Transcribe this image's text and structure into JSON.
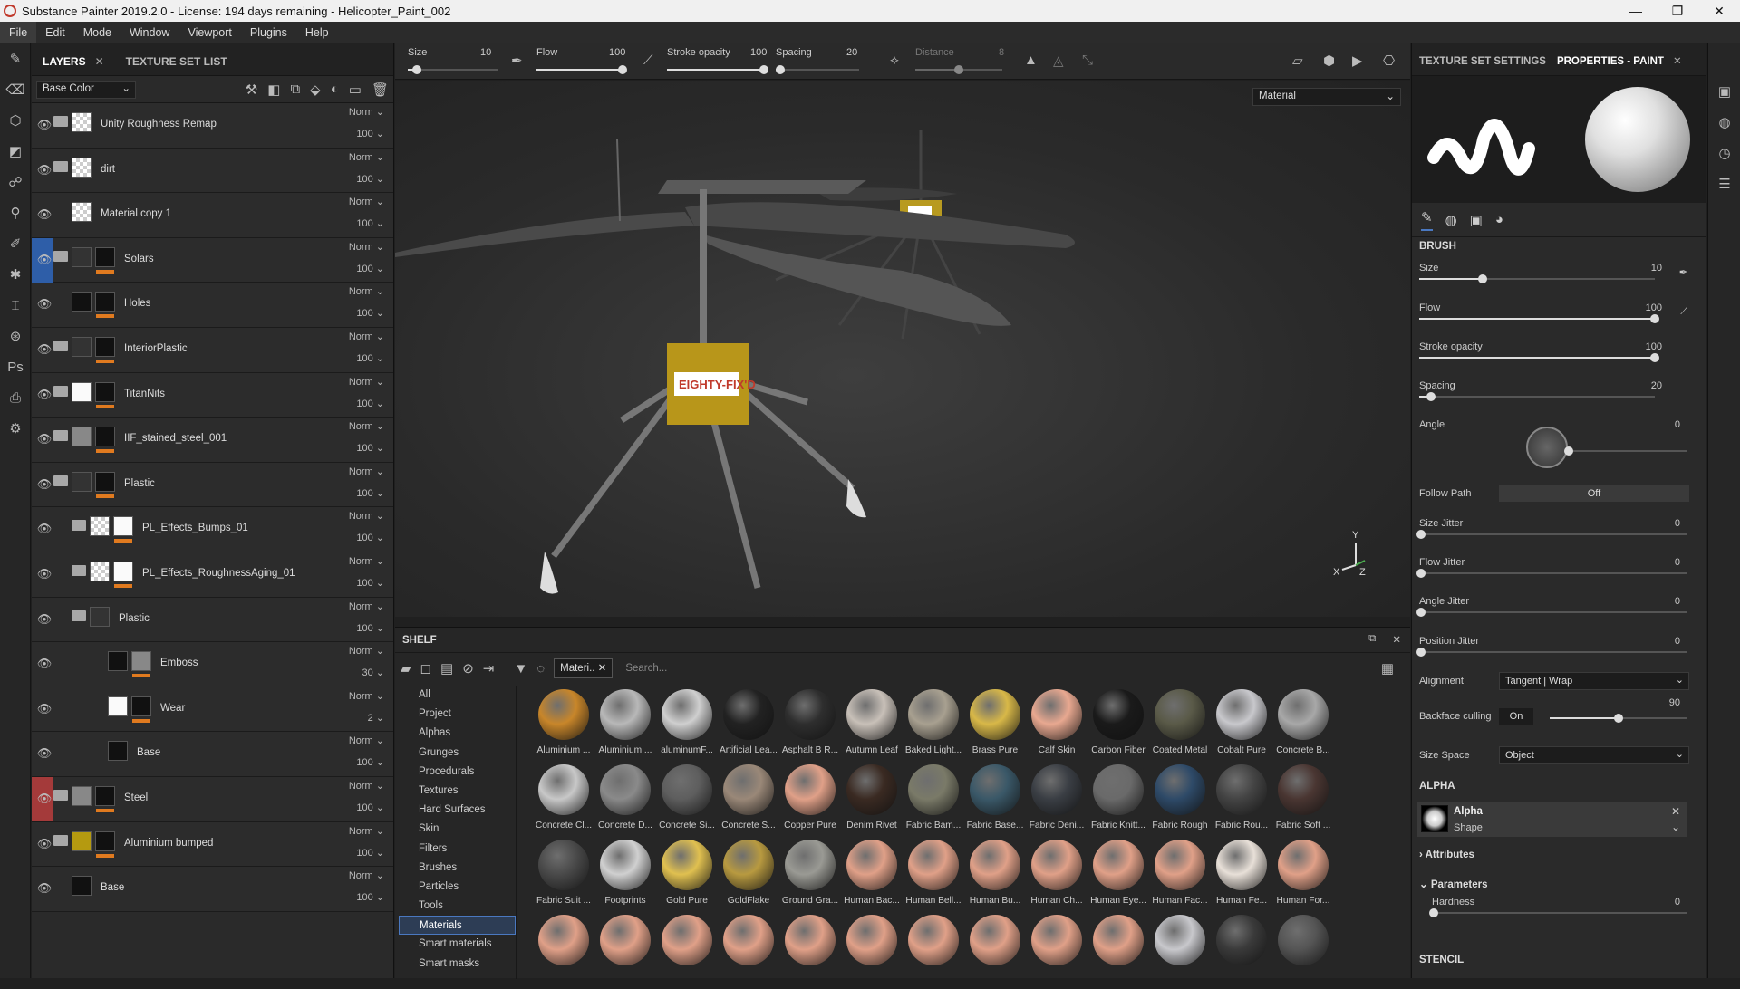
{
  "title": "Substance Painter 2019.2.0 - License: 194 days remaining - Helicopter_Paint_002",
  "window_controls": [
    "—",
    "❐",
    "✕"
  ],
  "menu": [
    "File",
    "Edit",
    "Mode",
    "Window",
    "Viewport",
    "Plugins",
    "Help"
  ],
  "layers_panel": {
    "tabs": [
      "LAYERS",
      "TEXTURE SET LIST"
    ],
    "channel": "Base Color",
    "layers": [
      {
        "name": "Unity Roughness Remap",
        "blend": "Norm",
        "opacity": "100",
        "folder": true,
        "thumb": "check",
        "mask": null,
        "indent": 0,
        "eye": "normal"
      },
      {
        "name": "dirt",
        "blend": "Norm",
        "opacity": "100",
        "folder": true,
        "thumb": "check",
        "mask": null,
        "indent": 0,
        "eye": "normal"
      },
      {
        "name": "Material copy 1",
        "blend": "Norm",
        "opacity": "100",
        "folder": false,
        "thumb": "check",
        "mask": null,
        "indent": 0,
        "eye": "normal"
      },
      {
        "name": "Solars",
        "blend": "Norm",
        "opacity": "100",
        "folder": true,
        "thumb": "dark",
        "mask": "black",
        "indent": 0,
        "eye": "blue"
      },
      {
        "name": "Holes",
        "blend": "Norm",
        "opacity": "100",
        "folder": false,
        "thumb": "black",
        "mask": "black",
        "indent": 0,
        "eye": "normal"
      },
      {
        "name": "InteriorPlastic",
        "blend": "Norm",
        "opacity": "100",
        "folder": true,
        "thumb": "dark",
        "mask": "black",
        "indent": 0,
        "eye": "normal"
      },
      {
        "name": "TitanNits",
        "blend": "Norm",
        "opacity": "100",
        "folder": true,
        "thumb": "white",
        "mask": "black",
        "indent": 0,
        "eye": "normal"
      },
      {
        "name": "IIF_stained_steel_001",
        "blend": "Norm",
        "opacity": "100",
        "folder": true,
        "thumb": "grey",
        "mask": "black",
        "indent": 0,
        "eye": "normal"
      },
      {
        "name": "Plastic",
        "blend": "Norm",
        "opacity": "100",
        "folder": true,
        "thumb": "dark",
        "mask": "black",
        "indent": 0,
        "eye": "normal"
      },
      {
        "name": "PL_Effects_Bumps_01",
        "blend": "Norm",
        "opacity": "100",
        "folder": true,
        "thumb": "check",
        "mask": "white",
        "indent": 1,
        "eye": "normal"
      },
      {
        "name": "PL_Effects_RoughnessAging_01",
        "blend": "Norm",
        "opacity": "100",
        "folder": true,
        "thumb": "check",
        "mask": "white",
        "indent": 1,
        "eye": "normal"
      },
      {
        "name": "Plastic",
        "blend": "Norm",
        "opacity": "100",
        "folder": true,
        "thumb": "dark",
        "mask": null,
        "indent": 1,
        "eye": "normal"
      },
      {
        "name": "Emboss",
        "blend": "Norm",
        "opacity": "30",
        "folder": false,
        "thumb": "black",
        "mask": "grey",
        "indent": 2,
        "eye": "normal"
      },
      {
        "name": "Wear",
        "blend": "Norm",
        "opacity": "2",
        "folder": false,
        "thumb": "white",
        "mask": "black",
        "indent": 2,
        "eye": "normal"
      },
      {
        "name": "Base",
        "blend": "Norm",
        "opacity": "100",
        "folder": false,
        "thumb": "black",
        "mask": null,
        "indent": 2,
        "eye": "normal"
      },
      {
        "name": "Steel",
        "blend": "Norm",
        "opacity": "100",
        "folder": true,
        "thumb": "grey",
        "mask": "black",
        "indent": 0,
        "eye": "red"
      },
      {
        "name": "Aluminium bumped",
        "blend": "Norm",
        "opacity": "100",
        "folder": true,
        "thumb": "gold",
        "mask": "black",
        "indent": 0,
        "eye": "normal"
      },
      {
        "name": "Base",
        "blend": "Norm",
        "opacity": "100",
        "folder": false,
        "thumb": "black",
        "mask": null,
        "indent": 0,
        "eye": "normal"
      }
    ]
  },
  "toolbar": {
    "size_label": "Size",
    "size_value": "10",
    "size_level": 0.1,
    "flow_label": "Flow",
    "flow_value": "100",
    "flow_level": 1.0,
    "stroke_label": "Stroke opacity",
    "stroke_value": "100",
    "stroke_level": 1.0,
    "spacing_label": "Spacing",
    "spacing_value": "20",
    "spacing_level": 0.05,
    "distance_label": "Distance",
    "distance_value": "8",
    "distance_level": 0.5
  },
  "viewport": {
    "display_mode": "Material",
    "decal_text": "EIGHTY-FIX'D",
    "axis_y": "Y",
    "axis_x": "X",
    "axis_z": "Z"
  },
  "shelf": {
    "title": "SHELF",
    "filter": "Materi..",
    "search_placeholder": "Search...",
    "categories": [
      "All",
      "Project",
      "Alphas",
      "Grunges",
      "Procedurals",
      "Textures",
      "Hard Surfaces",
      "Skin",
      "Filters",
      "Brushes",
      "Particles",
      "Tools",
      "Materials",
      "Smart materials",
      "Smart masks"
    ],
    "selected_category": "Materials",
    "materials": [
      {
        "name": "Aluminium ...",
        "color": "#c8862a"
      },
      {
        "name": "Aluminium ...",
        "color": "#b8b8b8"
      },
      {
        "name": "aluminumF...",
        "color": "#cfcfcf"
      },
      {
        "name": "Artificial Lea...",
        "color": "#222"
      },
      {
        "name": "Asphalt B R...",
        "color": "#2e2e2e"
      },
      {
        "name": "Autumn Leaf",
        "color": "#c8c0b8"
      },
      {
        "name": "Baked Light...",
        "color": "#a8a090"
      },
      {
        "name": "Brass Pure",
        "color": "#d8b848"
      },
      {
        "name": "Calf Skin",
        "color": "#e8a890"
      },
      {
        "name": "Carbon Fiber",
        "color": "#1a1a1a"
      },
      {
        "name": "Coated Metal",
        "color": "#5a5a48"
      },
      {
        "name": "Cobalt Pure",
        "color": "#c8c8cc"
      },
      {
        "name": "Concrete B...",
        "color": "#a8a8a8"
      },
      {
        "name": "Concrete Cl...",
        "color": "#c8c8c8"
      },
      {
        "name": "Concrete D...",
        "color": "#8a8a8a"
      },
      {
        "name": "Concrete Si...",
        "color": "#5e5e5e"
      },
      {
        "name": "Concrete S...",
        "color": "#9a8878"
      },
      {
        "name": "Copper Pure",
        "color": "#e0a088"
      },
      {
        "name": "Denim Rivet",
        "color": "#3a2a22"
      },
      {
        "name": "Fabric Bam...",
        "color": "#7a7a68"
      },
      {
        "name": "Fabric Base...",
        "color": "#3a5868"
      },
      {
        "name": "Fabric Deni...",
        "color": "#3a3e44"
      },
      {
        "name": "Fabric Knitt...",
        "color": "#6a6a6a"
      },
      {
        "name": "Fabric Rough",
        "color": "#2e4a68"
      },
      {
        "name": "Fabric Rou...",
        "color": "#444"
      },
      {
        "name": "Fabric Soft ...",
        "color": "#4a3632"
      },
      {
        "name": "Fabric Suit ...",
        "color": "#4a4a4a"
      },
      {
        "name": "Footprints",
        "color": "#d0d0d0"
      },
      {
        "name": "Gold Pure",
        "color": "#e0c050"
      },
      {
        "name": "GoldFlake",
        "color": "#b89a40"
      },
      {
        "name": "Ground Gra...",
        "color": "#9a9a94"
      },
      {
        "name": "Human Bac...",
        "color": "#e0a088"
      },
      {
        "name": "Human Bell...",
        "color": "#e0a088"
      },
      {
        "name": "Human Bu...",
        "color": "#e0a088"
      },
      {
        "name": "Human Ch...",
        "color": "#e0a088"
      },
      {
        "name": "Human Eye...",
        "color": "#e0a088"
      },
      {
        "name": "Human Fac...",
        "color": "#e0a088"
      },
      {
        "name": "Human Fe...",
        "color": "#e8e0d8"
      },
      {
        "name": "Human For...",
        "color": "#e0a088"
      },
      {
        "name": "",
        "color": "#e0a088"
      },
      {
        "name": "",
        "color": "#e0a088"
      },
      {
        "name": "",
        "color": "#e0a088"
      },
      {
        "name": "",
        "color": "#e0a088"
      },
      {
        "name": "",
        "color": "#e0a088"
      },
      {
        "name": "",
        "color": "#e0a088"
      },
      {
        "name": "",
        "color": "#e0a088"
      },
      {
        "name": "",
        "color": "#e0a088"
      },
      {
        "name": "",
        "color": "#e0a088"
      },
      {
        "name": "",
        "color": "#e0a088"
      },
      {
        "name": "",
        "color": "#c8c8cc"
      },
      {
        "name": "",
        "color": "#3a3a3a"
      },
      {
        "name": "",
        "color": "#555"
      }
    ]
  },
  "properties": {
    "tabs": [
      "TEXTURE SET SETTINGS",
      "PROPERTIES - PAINT"
    ],
    "brush_title": "BRUSH",
    "size_label": "Size",
    "size_value": "10",
    "size_level": 0.27,
    "flow_label": "Flow",
    "flow_value": "100",
    "flow_level": 1.0,
    "stroke_label": "Stroke opacity",
    "stroke_value": "100",
    "stroke_level": 1.0,
    "spacing_label": "Spacing",
    "spacing_value": "20",
    "spacing_level": 0.05,
    "angle_label": "Angle",
    "angle_value": "0",
    "follow_label": "Follow Path",
    "follow_value": "Off",
    "size_jitter_label": "Size Jitter",
    "size_jitter_value": "0",
    "flow_jitter_label": "Flow Jitter",
    "flow_jitter_value": "0",
    "angle_jitter_label": "Angle Jitter",
    "angle_jitter_value": "0",
    "pos_jitter_label": "Position Jitter",
    "pos_jitter_value": "0",
    "alignment_label": "Alignment",
    "alignment_value": "Tangent | Wrap",
    "backface_label": "Backface culling",
    "backface_value": "On",
    "backface_num": "90",
    "backface_level": 0.5,
    "sizespace_label": "Size Space",
    "sizespace_value": "Object",
    "alpha_title": "ALPHA",
    "alpha_name": "Alpha",
    "alpha_kind": "Shape",
    "attributes_label": "Attributes",
    "parameters_label": "Parameters",
    "hardness_label": "Hardness",
    "hardness_value": "0",
    "stencil_title": "STENCIL"
  }
}
